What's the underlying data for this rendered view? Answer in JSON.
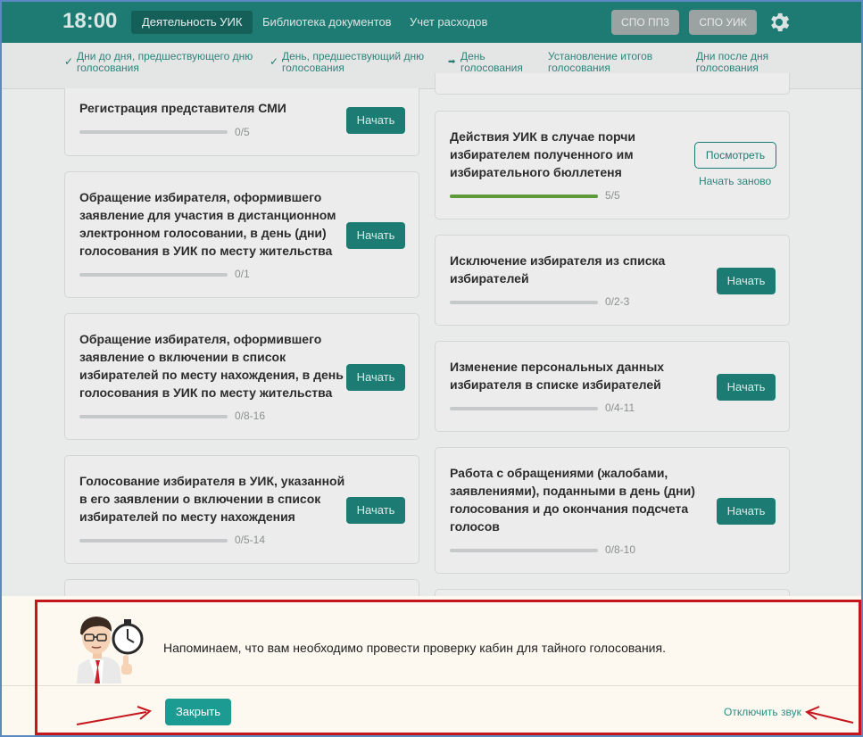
{
  "header": {
    "clock": "18:00",
    "nav": [
      {
        "label": "Деятельность УИК",
        "active": true
      },
      {
        "label": "Библиотека документов",
        "active": false
      },
      {
        "label": "Учет расходов",
        "active": false
      }
    ],
    "btn_spo_ppz": "СПО ПП3",
    "btn_spo_uik": "СПО УИК"
  },
  "steps": [
    {
      "line1": "Дни до дня, предшествующего дню",
      "line2": "голосования",
      "mark": "✓"
    },
    {
      "line1": "День, предшествующий дню",
      "line2": "голосования",
      "mark": "✓"
    },
    {
      "line1": "День",
      "line2": "голосования",
      "mark": "➡"
    },
    {
      "line1": "Установление итогов",
      "line2": "голосования",
      "mark": ""
    },
    {
      "line1": "Дни после дня",
      "line2": "голосования",
      "mark": ""
    }
  ],
  "left_cards": [
    {
      "title": [
        "Регистрация представителя СМИ"
      ],
      "progress": "0/5",
      "button": "Начать"
    },
    {
      "title": [
        "Обращение избирателя, оформившего",
        "заявление для участия в дистанционном",
        "электронном голосовании, в день (дни)",
        "голосования в УИК по месту жительства"
      ],
      "progress": "0/1",
      "button": "Начать"
    },
    {
      "title": [
        "Обращение избирателя, оформившего",
        "заявление о включении в список",
        "избирателей по месту нахождения, в день",
        "голосования в УИК по месту жительства"
      ],
      "progress": "0/8-16",
      "button": "Начать"
    },
    {
      "title": [
        "Голосование избирателя в УИК, указанной",
        "в его заявлении о включении в список",
        "избирателей по месту нахождения"
      ],
      "progress": "0/5-14",
      "button": "Начать"
    }
  ],
  "right_cards": [
    {
      "title": [
        "Действия УИК в случае порчи",
        "избирателем полученного им",
        "избирательного бюллетеня"
      ],
      "progress": "5/5",
      "fill": 1.0,
      "button": "Посмотреть",
      "restart": "Начать заново"
    },
    {
      "title": [
        "Исключение избирателя из списка",
        "избирателей"
      ],
      "progress": "0/2-3",
      "fill": 0,
      "button": "Начать"
    },
    {
      "title": [
        "Изменение персональных данных",
        "избирателя в списке избирателей"
      ],
      "progress": "0/4-11",
      "fill": 0,
      "button": "Начать"
    },
    {
      "title": [
        "Работа с обращениями (жалобами,",
        "заявлениями), поданными в день (дни)",
        "голосования и до окончания подсчета",
        "голосов"
      ],
      "progress": "0/8-10",
      "fill": 0,
      "button": "Начать"
    }
  ],
  "notice": {
    "message": "Напоминаем, что вам необходимо провести проверку кабин для тайного голосования.",
    "close_label": "Закрыть",
    "mute_label": "Отключить звук"
  },
  "colors": {
    "accent": "#1c7b72",
    "highlight_border": "#c4161c",
    "progress_done": "#5e9a3a"
  }
}
